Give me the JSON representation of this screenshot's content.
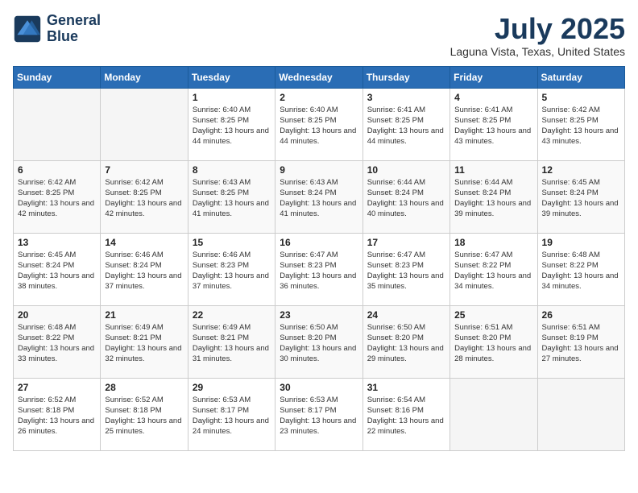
{
  "header": {
    "logo_line1": "General",
    "logo_line2": "Blue",
    "month_title": "July 2025",
    "location": "Laguna Vista, Texas, United States"
  },
  "days_of_week": [
    "Sunday",
    "Monday",
    "Tuesday",
    "Wednesday",
    "Thursday",
    "Friday",
    "Saturday"
  ],
  "weeks": [
    [
      {
        "day": "",
        "info": ""
      },
      {
        "day": "",
        "info": ""
      },
      {
        "day": "1",
        "info": "Sunrise: 6:40 AM\nSunset: 8:25 PM\nDaylight: 13 hours and 44 minutes."
      },
      {
        "day": "2",
        "info": "Sunrise: 6:40 AM\nSunset: 8:25 PM\nDaylight: 13 hours and 44 minutes."
      },
      {
        "day": "3",
        "info": "Sunrise: 6:41 AM\nSunset: 8:25 PM\nDaylight: 13 hours and 44 minutes."
      },
      {
        "day": "4",
        "info": "Sunrise: 6:41 AM\nSunset: 8:25 PM\nDaylight: 13 hours and 43 minutes."
      },
      {
        "day": "5",
        "info": "Sunrise: 6:42 AM\nSunset: 8:25 PM\nDaylight: 13 hours and 43 minutes."
      }
    ],
    [
      {
        "day": "6",
        "info": "Sunrise: 6:42 AM\nSunset: 8:25 PM\nDaylight: 13 hours and 42 minutes."
      },
      {
        "day": "7",
        "info": "Sunrise: 6:42 AM\nSunset: 8:25 PM\nDaylight: 13 hours and 42 minutes."
      },
      {
        "day": "8",
        "info": "Sunrise: 6:43 AM\nSunset: 8:25 PM\nDaylight: 13 hours and 41 minutes."
      },
      {
        "day": "9",
        "info": "Sunrise: 6:43 AM\nSunset: 8:24 PM\nDaylight: 13 hours and 41 minutes."
      },
      {
        "day": "10",
        "info": "Sunrise: 6:44 AM\nSunset: 8:24 PM\nDaylight: 13 hours and 40 minutes."
      },
      {
        "day": "11",
        "info": "Sunrise: 6:44 AM\nSunset: 8:24 PM\nDaylight: 13 hours and 39 minutes."
      },
      {
        "day": "12",
        "info": "Sunrise: 6:45 AM\nSunset: 8:24 PM\nDaylight: 13 hours and 39 minutes."
      }
    ],
    [
      {
        "day": "13",
        "info": "Sunrise: 6:45 AM\nSunset: 8:24 PM\nDaylight: 13 hours and 38 minutes."
      },
      {
        "day": "14",
        "info": "Sunrise: 6:46 AM\nSunset: 8:24 PM\nDaylight: 13 hours and 37 minutes."
      },
      {
        "day": "15",
        "info": "Sunrise: 6:46 AM\nSunset: 8:23 PM\nDaylight: 13 hours and 37 minutes."
      },
      {
        "day": "16",
        "info": "Sunrise: 6:47 AM\nSunset: 8:23 PM\nDaylight: 13 hours and 36 minutes."
      },
      {
        "day": "17",
        "info": "Sunrise: 6:47 AM\nSunset: 8:23 PM\nDaylight: 13 hours and 35 minutes."
      },
      {
        "day": "18",
        "info": "Sunrise: 6:47 AM\nSunset: 8:22 PM\nDaylight: 13 hours and 34 minutes."
      },
      {
        "day": "19",
        "info": "Sunrise: 6:48 AM\nSunset: 8:22 PM\nDaylight: 13 hours and 34 minutes."
      }
    ],
    [
      {
        "day": "20",
        "info": "Sunrise: 6:48 AM\nSunset: 8:22 PM\nDaylight: 13 hours and 33 minutes."
      },
      {
        "day": "21",
        "info": "Sunrise: 6:49 AM\nSunset: 8:21 PM\nDaylight: 13 hours and 32 minutes."
      },
      {
        "day": "22",
        "info": "Sunrise: 6:49 AM\nSunset: 8:21 PM\nDaylight: 13 hours and 31 minutes."
      },
      {
        "day": "23",
        "info": "Sunrise: 6:50 AM\nSunset: 8:20 PM\nDaylight: 13 hours and 30 minutes."
      },
      {
        "day": "24",
        "info": "Sunrise: 6:50 AM\nSunset: 8:20 PM\nDaylight: 13 hours and 29 minutes."
      },
      {
        "day": "25",
        "info": "Sunrise: 6:51 AM\nSunset: 8:20 PM\nDaylight: 13 hours and 28 minutes."
      },
      {
        "day": "26",
        "info": "Sunrise: 6:51 AM\nSunset: 8:19 PM\nDaylight: 13 hours and 27 minutes."
      }
    ],
    [
      {
        "day": "27",
        "info": "Sunrise: 6:52 AM\nSunset: 8:18 PM\nDaylight: 13 hours and 26 minutes."
      },
      {
        "day": "28",
        "info": "Sunrise: 6:52 AM\nSunset: 8:18 PM\nDaylight: 13 hours and 25 minutes."
      },
      {
        "day": "29",
        "info": "Sunrise: 6:53 AM\nSunset: 8:17 PM\nDaylight: 13 hours and 24 minutes."
      },
      {
        "day": "30",
        "info": "Sunrise: 6:53 AM\nSunset: 8:17 PM\nDaylight: 13 hours and 23 minutes."
      },
      {
        "day": "31",
        "info": "Sunrise: 6:54 AM\nSunset: 8:16 PM\nDaylight: 13 hours and 22 minutes."
      },
      {
        "day": "",
        "info": ""
      },
      {
        "day": "",
        "info": ""
      }
    ]
  ]
}
